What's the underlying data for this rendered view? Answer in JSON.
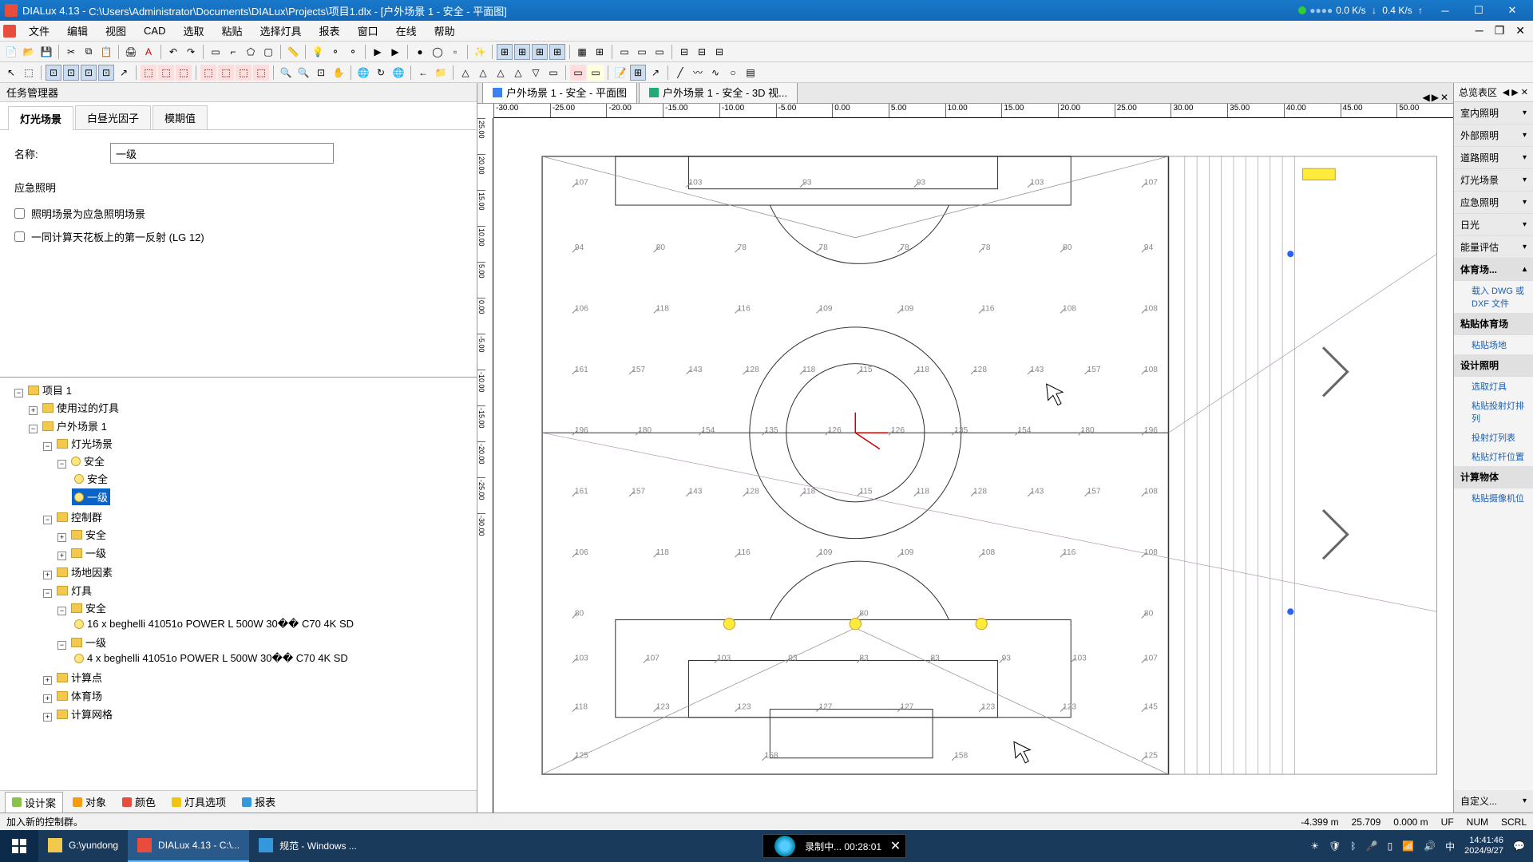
{
  "titlebar": {
    "app": "DIALux 4.13",
    "path": "C:\\Users\\Administrator\\Documents\\DIALux\\Projects\\项目1.dlx - [户外场景 1 - 安全 - 平面图]",
    "net_down": "0.0  K/s",
    "net_up": "0.4  K/s"
  },
  "menu": {
    "m0": "文件",
    "m1": "编辑",
    "m2": "视图",
    "m3": "CAD",
    "m4": "选取",
    "m5": "粘贴",
    "m6": "选择灯具",
    "m7": "报表",
    "m8": "窗口",
    "m9": "在线",
    "m10": "帮助"
  },
  "taskmgr": {
    "title": "任务管理器"
  },
  "tabs": {
    "t0": "灯光场景",
    "t1": "白昼光因子",
    "t2": "模期值"
  },
  "form": {
    "name_label": "名称:",
    "name_value": "一级",
    "emerg_label": "应急照明",
    "chk1": "照明场景为应急照明场景",
    "chk2": "一同计算天花板上的第一反射 (LG 12)"
  },
  "tree": {
    "root": "项目 1",
    "used": "使用过的灯具",
    "outdoor": "户外场景 1",
    "lscene": "灯光场景",
    "safe": "安全",
    "safe_c": "安全",
    "lvl1": "一级",
    "ctrlgrp": "控制群",
    "cg_safe": "安全",
    "cg_lvl1": "一级",
    "siteelem": "场地因素",
    "lumin": "灯具",
    "lum_safe": "安全",
    "lum_item1": "16 x beghelli 41051o POWER L 500W 30�� C70 4K SD",
    "lum_lvl1": "一级",
    "lum_item2": "4 x beghelli 41051o POWER L 500W 30�� C70 4K SD",
    "calcpt": "计算点",
    "stadium": "体育场",
    "calcgrid": "计算网格"
  },
  "btabs": {
    "b0": "设计案",
    "b1": "对象",
    "b2": "颜色",
    "b3": "灯具选项",
    "b4": "报表"
  },
  "doctabs": {
    "d0": "户外场景 1 - 安全 - 平面图",
    "d1": "户外场景 1 - 安全 - 3D 视..."
  },
  "ruler_h": [
    "-30.00",
    "-25.00",
    "-20.00",
    "-15.00",
    "-10.00",
    "-5.00",
    "0.00",
    "5.00",
    "10.00",
    "15.00",
    "20.00",
    "25.00",
    "30.00",
    "35.00",
    "40.00",
    "45.00",
    "50.00"
  ],
  "ruler_v": [
    "25.00",
    "20.00",
    "15.00",
    "10.00",
    "5.00",
    "0.00",
    "-5.00",
    "-10.00",
    "-15.00",
    "-20.00",
    "-25.00",
    "-30.00"
  ],
  "gridlabels": {
    "r1": [
      "107",
      "103",
      "93",
      "93",
      "103",
      "107"
    ],
    "r2": [
      "94",
      "80",
      "78",
      "78",
      "78",
      "78",
      "80",
      "94"
    ],
    "r3": [
      "106",
      "118",
      "116",
      "109",
      "109",
      "116",
      "108",
      "108"
    ],
    "r4": [
      "161",
      "157",
      "143",
      "128",
      "118",
      "115",
      "118",
      "128",
      "143",
      "157",
      "108"
    ],
    "r5": [
      "196",
      "180",
      "154",
      "135",
      "126",
      "126",
      "135",
      "154",
      "180",
      "196"
    ],
    "r6": [
      "161",
      "157",
      "143",
      "128",
      "118",
      "115",
      "118",
      "128",
      "143",
      "157",
      "108"
    ],
    "r7": [
      "106",
      "118",
      "116",
      "109",
      "109",
      "108",
      "116",
      "108"
    ],
    "r8": [
      "80",
      "80",
      "80"
    ],
    "r9": [
      "103",
      "107",
      "103",
      "93",
      "83",
      "83",
      "93",
      "103",
      "107"
    ],
    "r10": [
      "118",
      "123",
      "123",
      "127",
      "127",
      "123",
      "123",
      "145"
    ],
    "r11": [
      "125",
      "158",
      "158",
      "125"
    ]
  },
  "right": {
    "hdr": "总览表区",
    "c0": "室内照明",
    "c1": "外部照明",
    "c2": "道路照明",
    "c3": "灯光场景",
    "c4": "应急照明",
    "c5": "日光",
    "c6": "能量评估",
    "c7": "体育场...",
    "l0": "载入 DWG 或 DXF 文件",
    "h1": "粘贴体育场",
    "l1": "粘贴场地",
    "h2": "设计照明",
    "l2": "选取灯具",
    "l3": "粘贴投射灯排列",
    "l4": "投射灯列表",
    "l5": "粘贴灯杆位置",
    "h3": "计算物体",
    "l6": "粘贴摄像机位",
    "custom": "自定义..."
  },
  "status": {
    "msg": "加入新的控制群。",
    "x": "-4.399 m",
    "y": "25.709",
    "z": "0.000 m",
    "uf": "UF",
    "num": "NUM",
    "scrl": "SCRL"
  },
  "taskbar": {
    "t0": "G:\\yundong",
    "t1": "DIALux 4.13 - C:\\...",
    "t2": "规范 - Windows ...",
    "rec": "录制中... 00:28:01",
    "time": "14:41:46",
    "date": "2024/9/27"
  }
}
